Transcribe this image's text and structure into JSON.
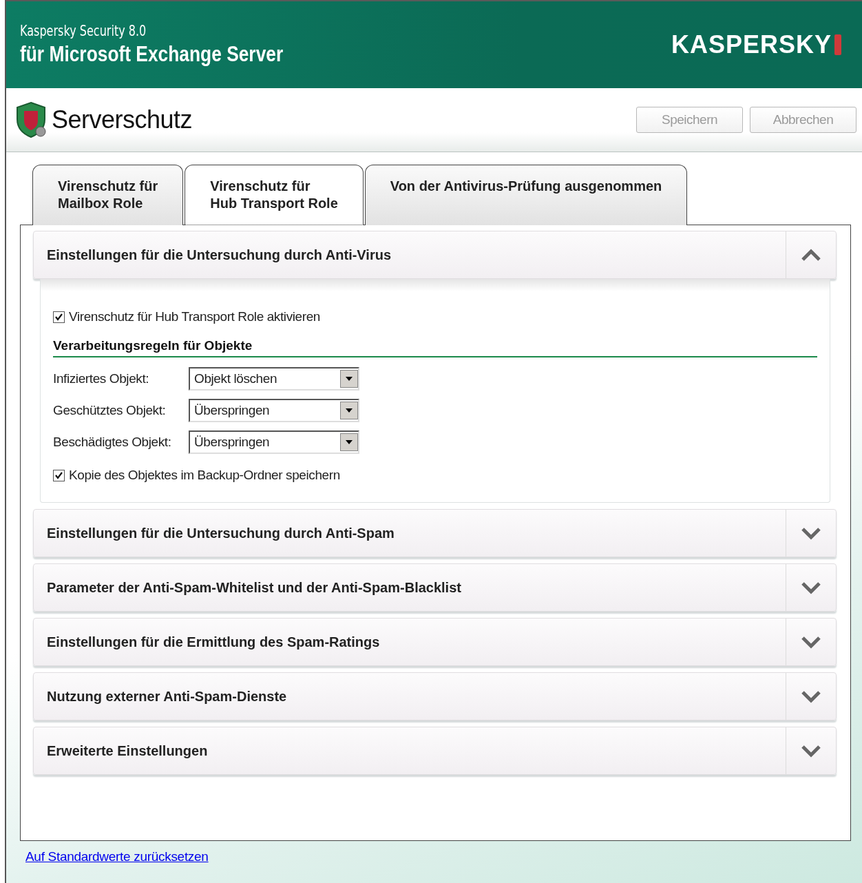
{
  "header": {
    "product_line": "Kaspersky Security 8.0",
    "product_name": "für Microsoft Exchange Server",
    "logo": "KASPERSKY"
  },
  "page": {
    "title": "Serverschutz",
    "buttons": [
      {
        "label": "Speichern",
        "disabled": true
      },
      {
        "label": "Abbrechen",
        "disabled": true
      }
    ]
  },
  "tabs": [
    {
      "label": "Virenschutz für\nMailbox Role",
      "selected": false
    },
    {
      "label": "Virenschutz für\nHub Transport Role",
      "selected": true
    },
    {
      "label": "Von der Antivirus-Prüfung ausgenommen",
      "selected": false
    }
  ],
  "sections": [
    {
      "title": "Einstellungen für die Untersuchung durch Anti-Virus",
      "expanded": true
    },
    {
      "title": "Einstellungen für die Untersuchung durch Anti-Spam",
      "expanded": false
    },
    {
      "title": "Parameter der Anti-Spam-Whitelist und der Anti-Spam-Blacklist",
      "expanded": false
    },
    {
      "title": "Einstellungen für die Ermittlung des Spam-Ratings",
      "expanded": false
    },
    {
      "title": "Nutzung externer Anti-Spam-Dienste",
      "expanded": false
    },
    {
      "title": "Erweiterte Einstellungen",
      "expanded": false
    }
  ],
  "antivirus_settings": {
    "enable": {
      "label": "Virenschutz für Hub Transport Role aktivieren",
      "checked": true
    },
    "group_title": "Verarbeitungsregeln für Objekte",
    "rules": [
      {
        "label": "Infiziertes Objekt:",
        "value": "Objekt löschen"
      },
      {
        "label": "Geschütztes Objekt:",
        "value": "Überspringen"
      },
      {
        "label": "Beschädigtes Objekt:",
        "value": "Überspringen"
      }
    ],
    "backup": {
      "label": "Kopie des Objektes im Backup-Ordner speichern",
      "checked": true
    }
  },
  "reset_link": "Auf Standardwerte zurücksetzen"
}
